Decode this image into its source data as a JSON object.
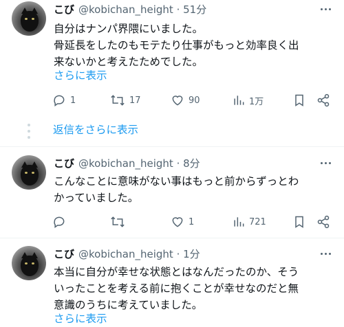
{
  "tweets": [
    {
      "name": "こび",
      "handle": "@kobichan_height · 51分",
      "text_lines": [
        "自分はナンパ界隈にいました。",
        "骨延長をしたのもモテたり仕事がもっと効率良く出",
        "来ないかと考えたためでした。"
      ],
      "show_more": "さらに表示",
      "replies": "1",
      "retweets": "17",
      "likes": "90",
      "views": "1万"
    },
    {
      "name": "こび",
      "handle": "@kobichan_height · 8分",
      "text_lines": [
        "こんなことに意味がない事はもっと前からずっとわ",
        "かっていました。"
      ],
      "replies": "",
      "retweets": "",
      "likes": "1",
      "views": "721"
    },
    {
      "name": "こび",
      "handle": "@kobichan_height · 1分",
      "text_lines": [
        "本当に自分が幸せな状態とはなんだったのか、そう",
        "いったことを考える前に抱くことが幸せなのだと無",
        "意識のうちに考えていました。"
      ],
      "show_more": "さらに表示"
    }
  ],
  "show_replies": "返信をさらに表示",
  "colors": {
    "accent": "#1d9bf0",
    "muted": "#536471",
    "text": "#0f1419"
  },
  "icons": [
    "more-icon",
    "reply-icon",
    "retweet-icon",
    "like-icon",
    "views-icon",
    "bookmark-icon",
    "share-icon"
  ]
}
